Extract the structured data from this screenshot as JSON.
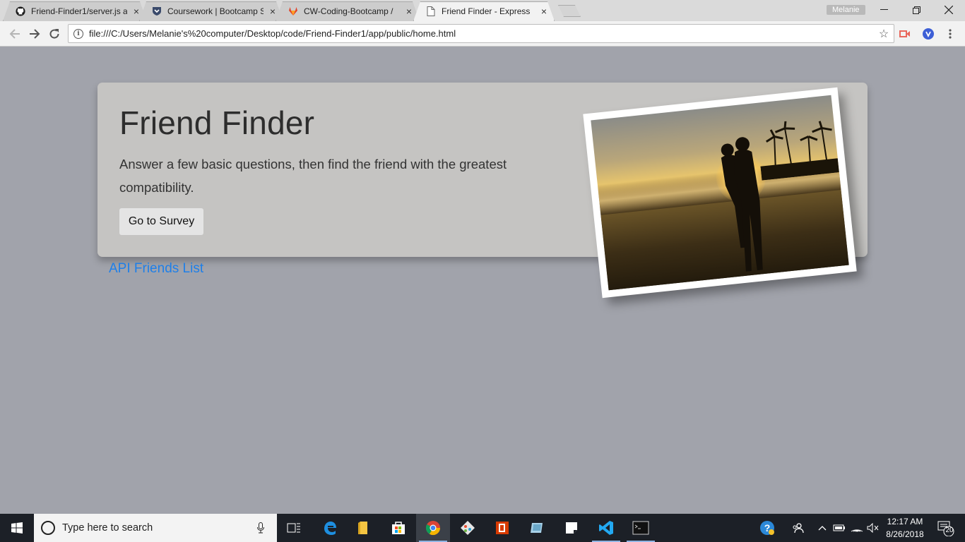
{
  "browser": {
    "tabs": [
      {
        "title": "Friend-Finder1/server.js a",
        "icon": "github-icon",
        "active": false
      },
      {
        "title": "Coursework | Bootcamp S",
        "icon": "bootcamp-shield-icon",
        "active": false
      },
      {
        "title": "CW-Coding-Bootcamp /",
        "icon": "gitlab-icon",
        "active": false
      },
      {
        "title": "Friend Finder - Express",
        "icon": "page-icon",
        "active": true
      }
    ],
    "close_glyph": "×",
    "profile_name": "Melanie",
    "url": "file:///C:/Users/Melanie's%20computer/Desktop/code/Friend-Finder1/app/public/home.html"
  },
  "page": {
    "title": "Friend Finder",
    "lead": "Answer a few basic questions, then find the friend with the greatest compatibility.",
    "survey_button": "Go to Survey",
    "api_link": "API Friends List",
    "photo_alt": "Couple embracing on a beach at sunset"
  },
  "taskbar": {
    "search_placeholder": "Type here to search",
    "apps": [
      "task-view-icon",
      "edge-icon",
      "file-explorer-icon",
      "store-icon",
      "chrome-icon",
      "git-icon",
      "office-icon",
      "vm-icon",
      "sticky-notes-icon",
      "vscode-icon",
      "terminal-icon"
    ],
    "time": "12:17 AM",
    "date": "8/26/2018",
    "notification_count": "20"
  },
  "colors": {
    "page_bg": "#a1a3ab",
    "jumbotron_bg": "#c5c4c2",
    "link": "#1e7fe8",
    "taskbar_bg": "#1c2027"
  }
}
